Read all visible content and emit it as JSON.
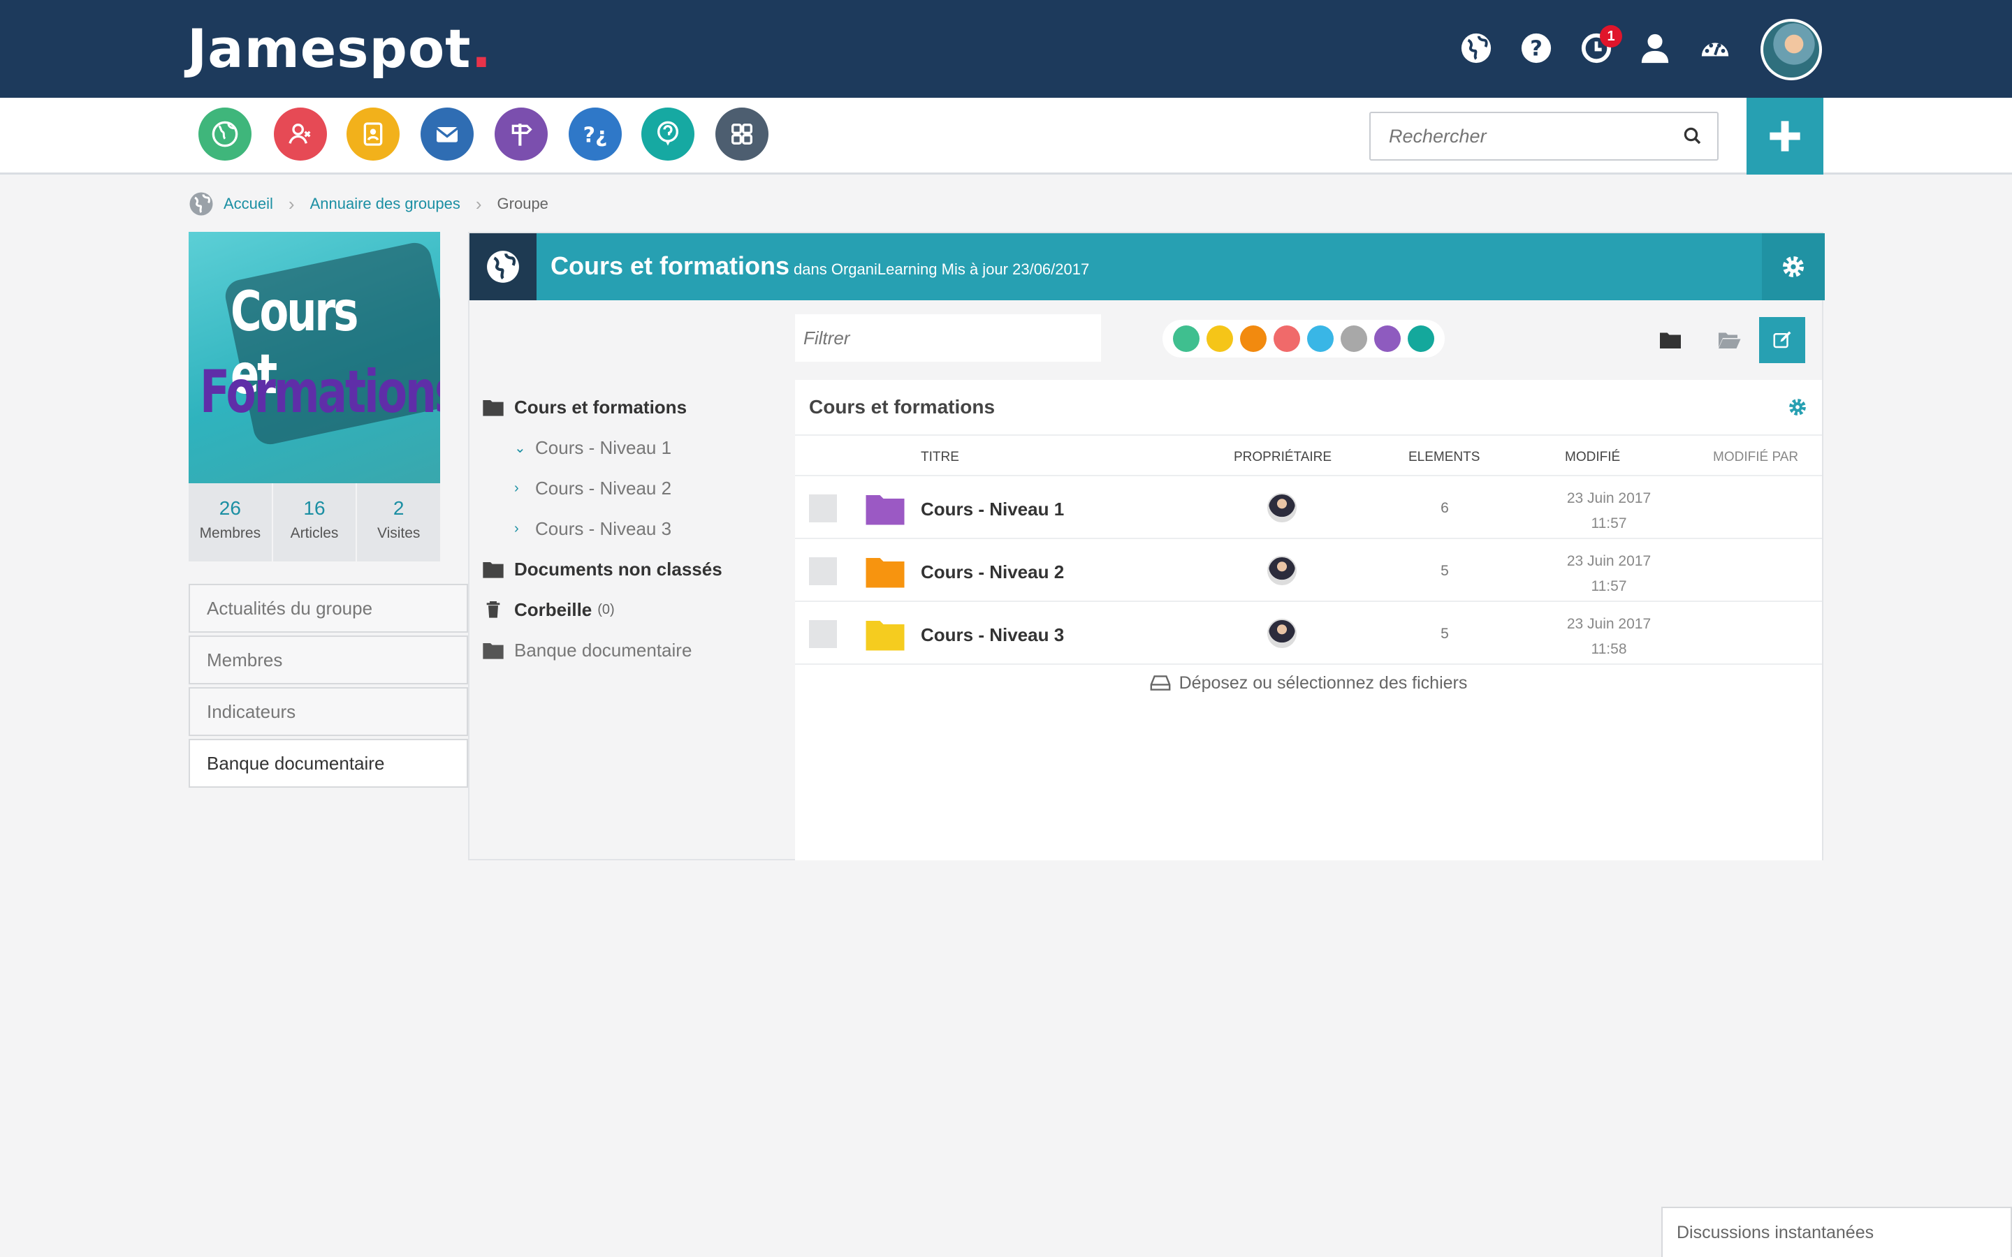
{
  "header": {
    "logo": "Jamespot",
    "logo_dot": ".",
    "notif_count": "1"
  },
  "apps": [
    {
      "name": "globe",
      "color": "#3fb67b"
    },
    {
      "name": "users",
      "color": "#e64a55"
    },
    {
      "name": "contacts",
      "color": "#f2b11b"
    },
    {
      "name": "mail",
      "color": "#2f6db3"
    },
    {
      "name": "signpost",
      "color": "#7b4fae"
    },
    {
      "name": "faq",
      "color": "#2f78c8"
    },
    {
      "name": "help",
      "color": "#16a9a2"
    },
    {
      "name": "apps-grid",
      "color": "#4d5e70"
    }
  ],
  "search": {
    "placeholder": "Rechercher"
  },
  "breadcrumb": {
    "home": "Accueil",
    "directory": "Annuaire des groupes",
    "current": "Groupe"
  },
  "group": {
    "image_line1": "Cours et",
    "image_line2": "Formations",
    "stats": [
      {
        "value": "26",
        "label": "Membres"
      },
      {
        "value": "16",
        "label": "Articles"
      },
      {
        "value": "2",
        "label": "Visites"
      }
    ],
    "nav": [
      "Actualités du groupe",
      "Membres",
      "Indicateurs",
      "Banque documentaire"
    ],
    "active_nav": "Banque documentaire"
  },
  "panel": {
    "title": "Cours et formations",
    "subtitle": "dans OrganiLearning  Mis à jour 23/06/2017",
    "filter_placeholder": "Filtrer",
    "color_filters": [
      "#3fbf8f",
      "#f5c518",
      "#f28a0f",
      "#f06a6a",
      "#39b6e6",
      "#a8a8a8",
      "#8e5bbf",
      "#14a89c"
    ]
  },
  "tree": {
    "root": "Cours et formations",
    "children": [
      "Cours - Niveau 1",
      "Cours - Niveau 2",
      "Cours - Niveau 3"
    ],
    "unclassified": "Documents non classés",
    "trash": "Corbeille",
    "trash_count": "(0)",
    "bank": "Banque documentaire"
  },
  "list": {
    "title": "Cours et formations",
    "columns": {
      "title": "TITRE",
      "owner": "PROPRIÉTAIRE",
      "elements": "ELEMENTS",
      "modified": "MODIFIÉ",
      "modified_by": "MODIFIÉ PAR"
    },
    "rows": [
      {
        "name": "Cours - Niveau 1",
        "folder_color": "#9b59c4",
        "elements": "6",
        "date": "23 Juin 2017",
        "time": "11:57"
      },
      {
        "name": "Cours - Niveau 2",
        "folder_color": "#f7940f",
        "elements": "5",
        "date": "23 Juin 2017",
        "time": "11:57"
      },
      {
        "name": "Cours - Niveau 3",
        "folder_color": "#f5cc1f",
        "elements": "5",
        "date": "23 Juin 2017",
        "time": "11:58"
      }
    ],
    "drop_text": "Déposez ou sélectionnez des fichiers"
  },
  "chat": {
    "label": "Discussions instantanées"
  }
}
